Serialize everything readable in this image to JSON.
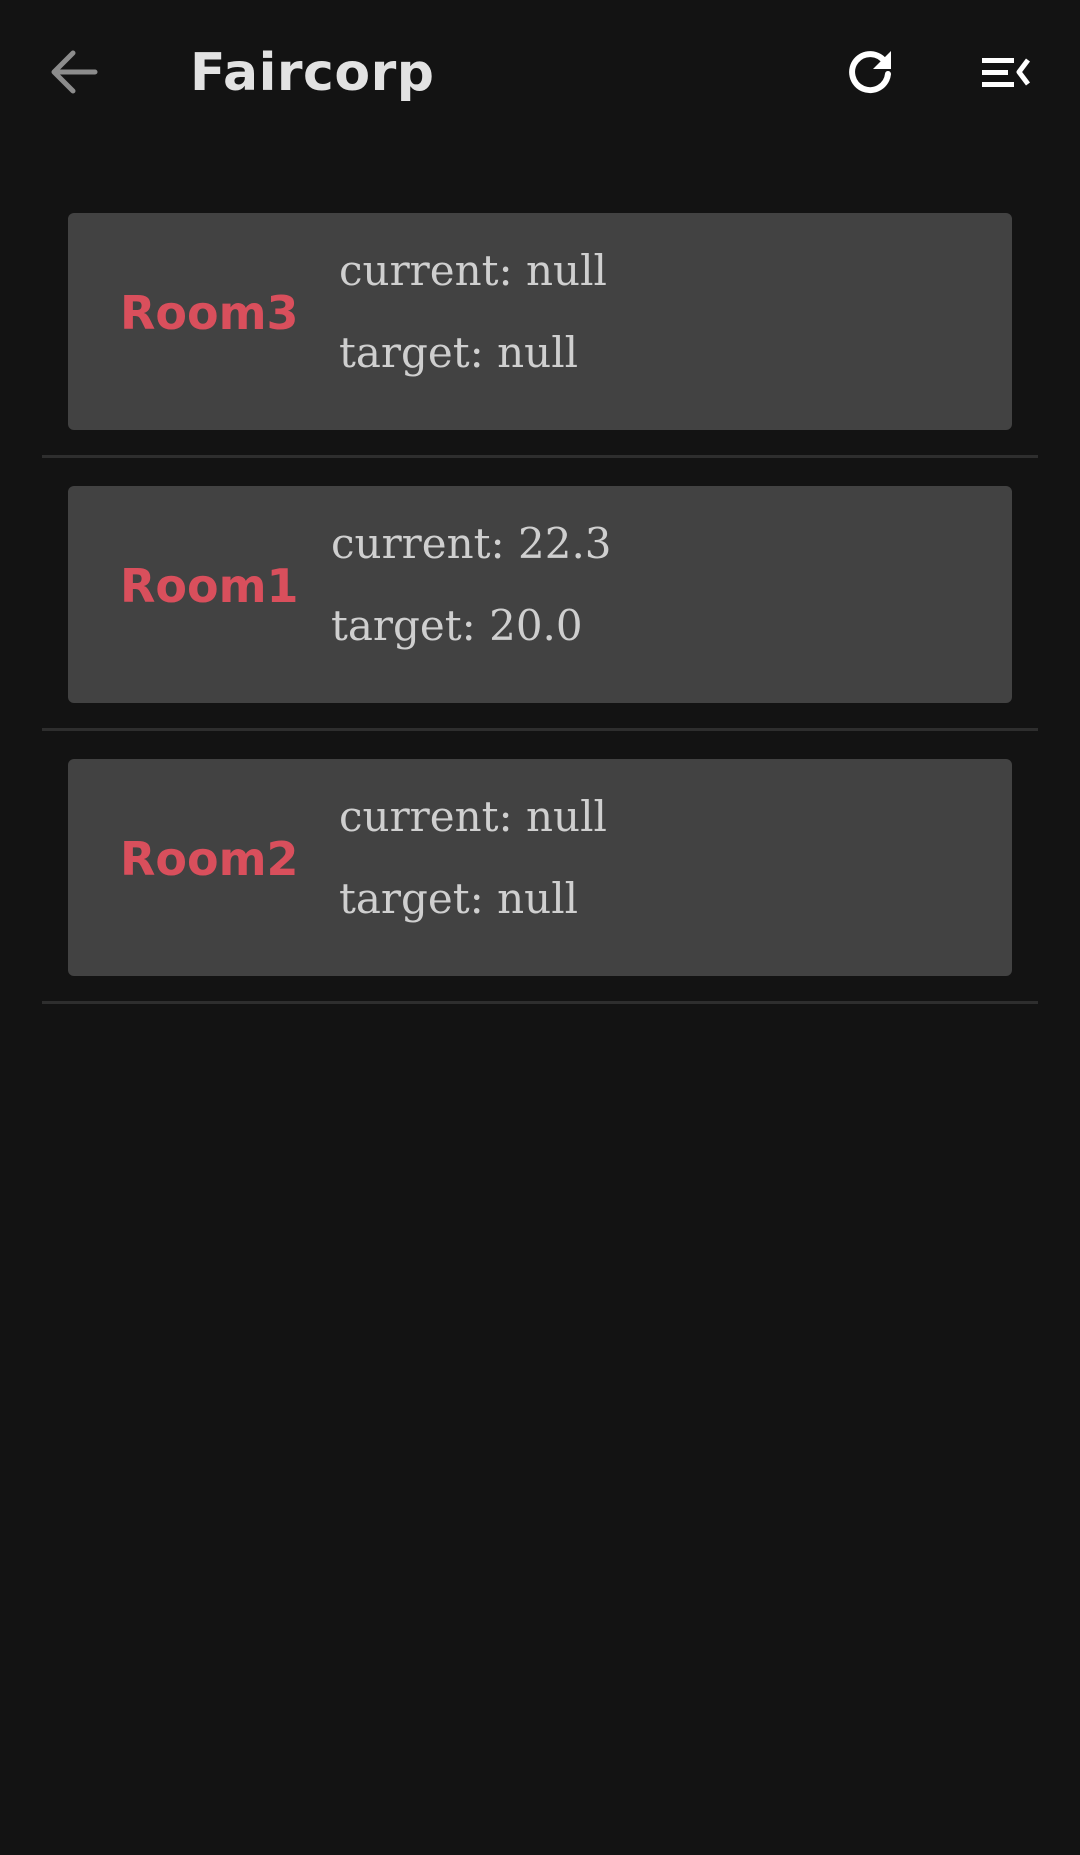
{
  "app_bar": {
    "title": "Faircorp",
    "back_icon": "arrow-left-icon",
    "refresh_icon": "refresh-icon",
    "menu_icon": "menu-collapse-icon"
  },
  "colors": {
    "background": "#131313",
    "card": "#424242",
    "room_name": "#d94f5c",
    "text": "#cfcfcf",
    "title": "#e2e2e2"
  },
  "rooms": [
    {
      "name": "Room3",
      "current": "current: null",
      "target": "target: null"
    },
    {
      "name": "Room1",
      "current": "current: 22.3",
      "target": "target: 20.0"
    },
    {
      "name": "Room2",
      "current": "current: null",
      "target": "target: null"
    }
  ]
}
